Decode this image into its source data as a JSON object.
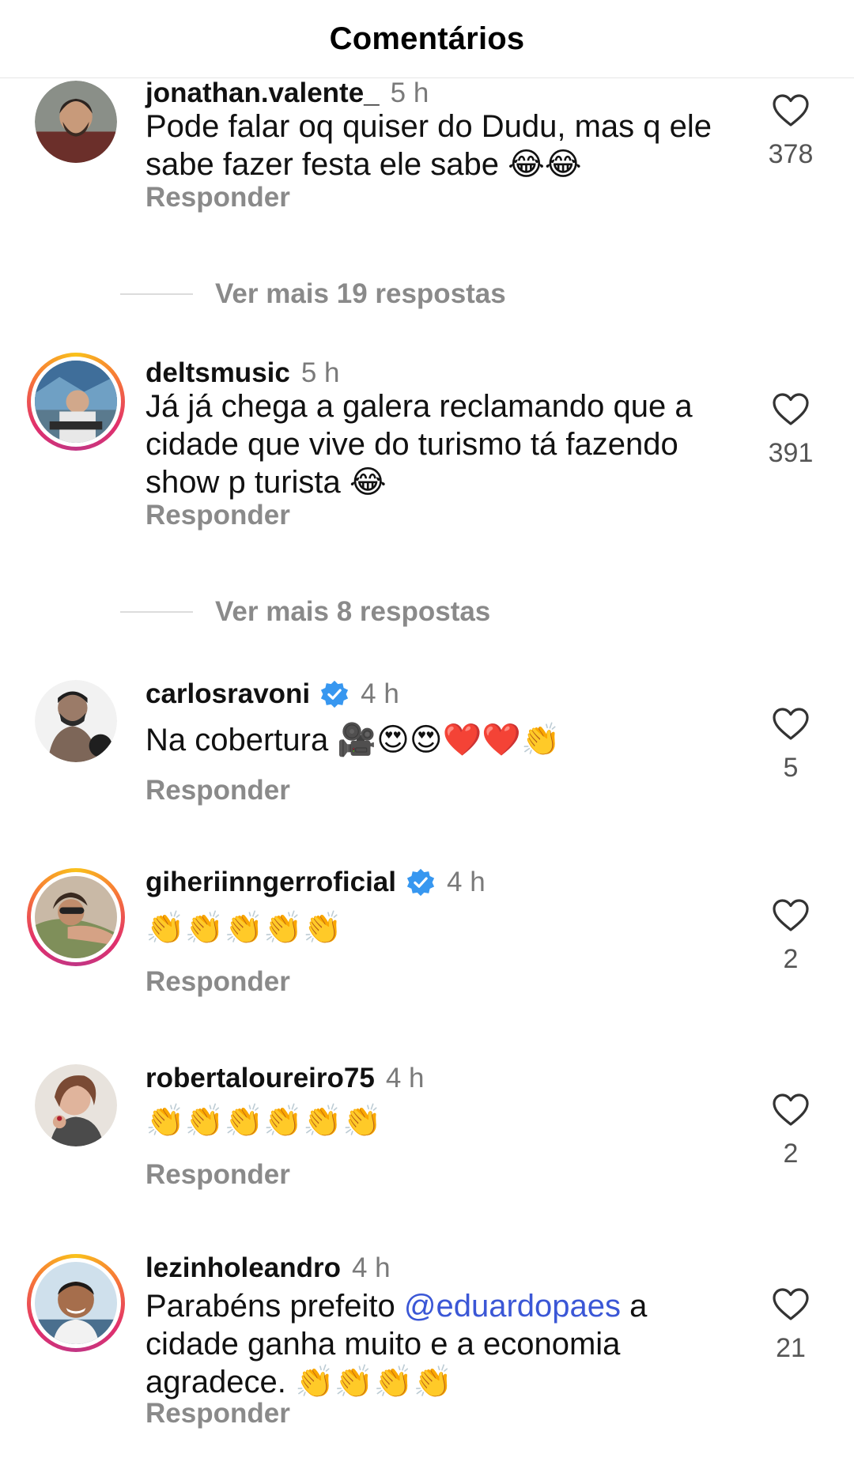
{
  "header": {
    "title": "Comentários"
  },
  "comments": [
    {
      "username": "jonathan.valente_",
      "time": "5 h",
      "verified": false,
      "text": "Pode falar oq quiser do Dudu, mas q ele sabe fazer festa ele sabe 😂😂",
      "reply_label": "Responder",
      "likes": "378",
      "more_replies": "Ver mais 19 respostas"
    },
    {
      "username": "deltsmusic",
      "time": "5 h",
      "verified": false,
      "text": "Já já chega a galera reclamando que a cidade que vive do turismo tá fazendo show p turista 😂",
      "reply_label": "Responder",
      "likes": "391",
      "more_replies": "Ver mais 8 respostas"
    },
    {
      "username": "carlosravoni",
      "time": "4 h",
      "verified": true,
      "text": "Na cobertura 🎥😍😍❤️❤️👏",
      "reply_label": "Responder",
      "likes": "5"
    },
    {
      "username": "giheriinngerroficial",
      "time": "4 h",
      "verified": true,
      "text": "👏👏👏👏👏",
      "reply_label": "Responder",
      "likes": "2"
    },
    {
      "username": "robertaloureiro75",
      "time": "4 h",
      "verified": false,
      "text": "👏👏👏👏👏👏",
      "reply_label": "Responder",
      "likes": "2"
    },
    {
      "username": "lezinholeandro",
      "time": "4 h",
      "verified": false,
      "text_before": "Parabéns prefeito ",
      "mention": "@eduardopaes",
      "text_after": " a cidade ganha muito e a economia agradece. 👏👏👏👏",
      "reply_label": "Responder",
      "likes": "21"
    }
  ],
  "icons": {
    "like": "heart-icon",
    "verified": "verified-badge-icon"
  },
  "colors": {
    "mention": "#3b57d6",
    "secondary_text": "#8a8a8a",
    "verified": "#3797f0"
  }
}
